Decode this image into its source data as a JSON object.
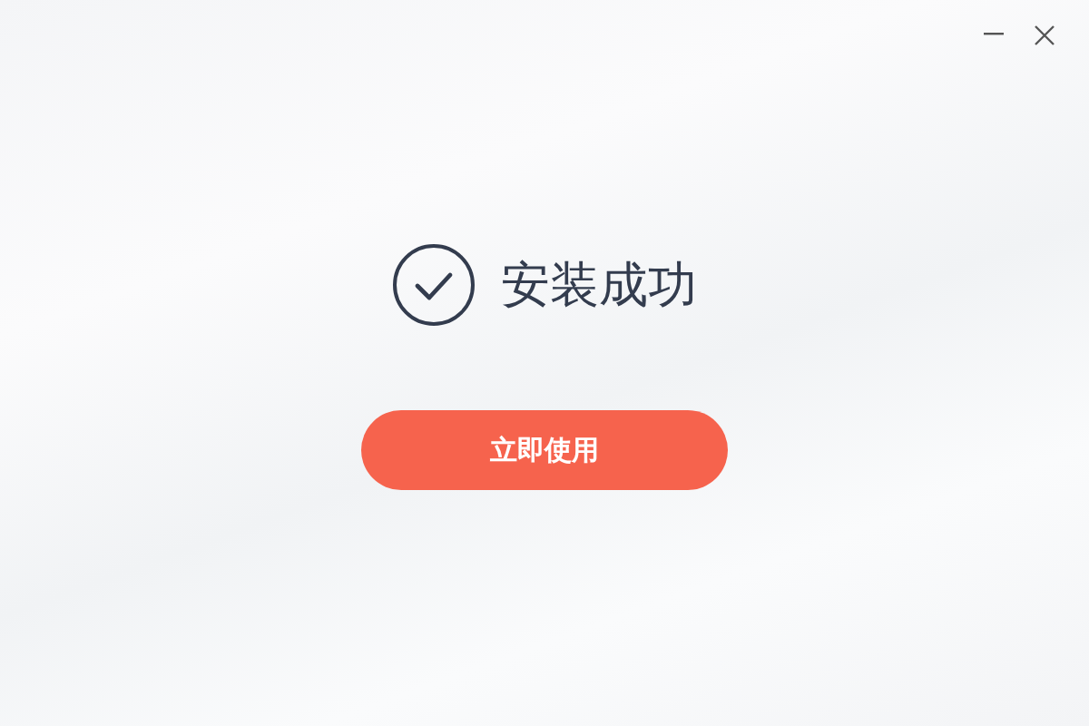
{
  "window_controls": [
    {
      "kind": "minimize"
    },
    {
      "kind": "close"
    }
  ],
  "status": {
    "title": "安装成功"
  },
  "primary_button": {
    "label": "立即使用"
  }
}
